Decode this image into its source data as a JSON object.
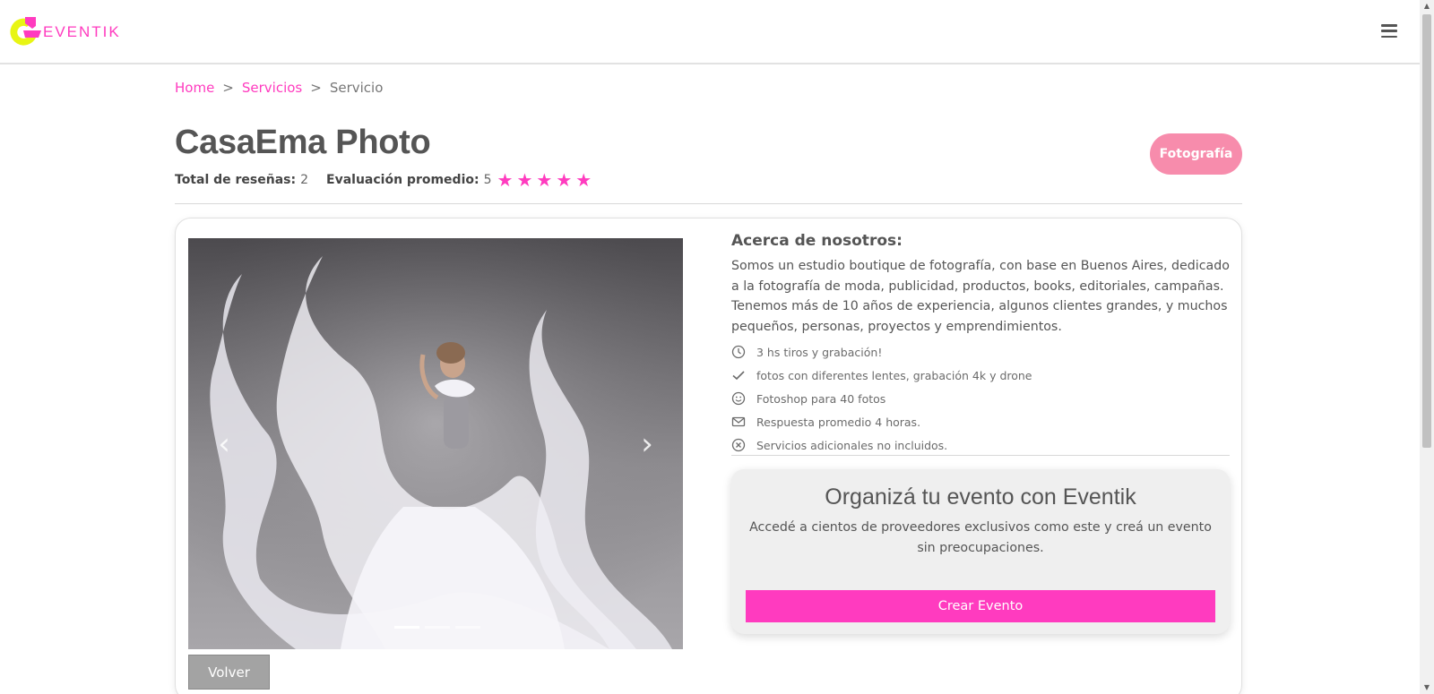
{
  "header": {
    "logo_text": "EVENTIK",
    "brand_colors": {
      "pink": "#ff3bbf",
      "yellow": "#e8f514"
    },
    "menu_icon": "hamburger-icon"
  },
  "breadcrumb": {
    "items": [
      "Home",
      "Servicios"
    ],
    "separator": ">",
    "current": "Servicio"
  },
  "service": {
    "title": "CasaEma Photo",
    "reviews_label": "Total de reseñas:",
    "reviews_count": "2",
    "rating_label": "Evaluación promedio:",
    "rating_value": "5",
    "rating_stars": 5,
    "category": "Fotografía",
    "category_color": "#f78cac"
  },
  "carousel": {
    "prev_icon": "chevron-left-icon",
    "next_icon": "chevron-right-icon",
    "slide_count": 3,
    "active_index": 0
  },
  "about": {
    "title": "Acerca de nosotros:",
    "text": "Somos un estudio boutique de fotografía, con base en Buenos Aires, dedicado a la fotografía de moda, publicidad, productos, books, editoriales, campañas. Tenemos más de 10 años de experiencia, algunos clientes grandes, y muchos pequeños, personas, proyectos y emprendimientos.",
    "features": [
      {
        "icon": "clock-icon",
        "text": "3 hs tiros y grabación!"
      },
      {
        "icon": "check-icon",
        "text": "fotos con diferentes lentes, grabación 4k y drone"
      },
      {
        "icon": "smile-icon",
        "text": "Fotoshop para 40 fotos"
      },
      {
        "icon": "envelope-icon",
        "text": "Respuesta promedio 4 horas."
      },
      {
        "icon": "x-circle-icon",
        "text": "Servicios adicionales no incluidos."
      }
    ]
  },
  "cta": {
    "title": "Organizá tu evento con Eventik",
    "text": "Accedé a cientos de proveedores exclusivos como este y creá un evento sin preocupaciones.",
    "button": "Crear Evento"
  },
  "actions": {
    "back": "Volver"
  }
}
